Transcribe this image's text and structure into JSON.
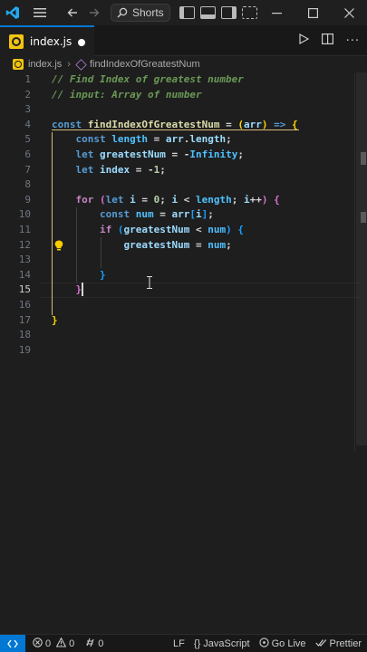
{
  "titlebar": {
    "search_label": "Shorts",
    "icons": [
      "vscode-logo",
      "menu-icon",
      "back-arrow-icon",
      "forward-arrow-icon",
      "search-icon",
      "layout-icons",
      "minimize-icon",
      "maximize-icon",
      "close-icon"
    ]
  },
  "tabs": [
    {
      "label": "index.js",
      "modified": true,
      "active": true
    }
  ],
  "breadcrumb": {
    "file": "index.js",
    "symbol": "findIndexOfGreatestNum"
  },
  "editor": {
    "line_numbers": [
      "1",
      "2",
      "3",
      "4",
      "5",
      "6",
      "7",
      "8",
      "9",
      "10",
      "11",
      "12",
      "13",
      "14",
      "15",
      "16",
      "17",
      "18",
      "19"
    ],
    "active_line": "15",
    "lines": [
      [
        [
          "cm",
          "// Find Index of greatest number"
        ]
      ],
      [
        [
          "cm",
          "// input: Array of number"
        ]
      ],
      [],
      [
        [
          "kw",
          "const "
        ],
        [
          "fn",
          "findIndexOfGreatestNum"
        ],
        [
          "op",
          " = "
        ],
        [
          "b1",
          "("
        ],
        [
          "var",
          "arr"
        ],
        [
          "b1",
          ")"
        ],
        [
          "op",
          " "
        ],
        [
          "kw",
          "=>"
        ],
        [
          "op",
          " "
        ],
        [
          "b1",
          "{"
        ]
      ],
      [
        [
          "op",
          "    "
        ],
        [
          "kw",
          "const "
        ],
        [
          "cnst",
          "length"
        ],
        [
          "op",
          " = "
        ],
        [
          "var",
          "arr"
        ],
        [
          "op",
          "."
        ],
        [
          "var",
          "length"
        ],
        [
          "op",
          ";"
        ]
      ],
      [
        [
          "op",
          "    "
        ],
        [
          "kw",
          "let "
        ],
        [
          "var",
          "greatestNum"
        ],
        [
          "op",
          " = -"
        ],
        [
          "cnst",
          "Infinity"
        ],
        [
          "op",
          ";"
        ]
      ],
      [
        [
          "op",
          "    "
        ],
        [
          "kw",
          "let "
        ],
        [
          "var",
          "index"
        ],
        [
          "op",
          " = -"
        ],
        [
          "num",
          "1"
        ],
        [
          "op",
          ";"
        ]
      ],
      [],
      [
        [
          "op",
          "    "
        ],
        [
          "ctl",
          "for "
        ],
        [
          "b2",
          "("
        ],
        [
          "kw",
          "let "
        ],
        [
          "var",
          "i"
        ],
        [
          "op",
          " = "
        ],
        [
          "num",
          "0"
        ],
        [
          "op",
          "; "
        ],
        [
          "var",
          "i"
        ],
        [
          "op",
          " < "
        ],
        [
          "cnst",
          "length"
        ],
        [
          "op",
          "; "
        ],
        [
          "var",
          "i"
        ],
        [
          "op",
          "++"
        ],
        [
          "b2",
          ")"
        ],
        [
          "op",
          " "
        ],
        [
          "b2",
          "{"
        ]
      ],
      [
        [
          "op",
          "        "
        ],
        [
          "kw",
          "const "
        ],
        [
          "cnst",
          "num"
        ],
        [
          "op",
          " = "
        ],
        [
          "var",
          "arr"
        ],
        [
          "b3",
          "["
        ],
        [
          "var",
          "i"
        ],
        [
          "b3",
          "]"
        ],
        [
          "op",
          ";"
        ]
      ],
      [
        [
          "op",
          "        "
        ],
        [
          "ctl",
          "if "
        ],
        [
          "b3",
          "("
        ],
        [
          "var",
          "greatestNum"
        ],
        [
          "op",
          " < "
        ],
        [
          "cnst",
          "num"
        ],
        [
          "b3",
          ")"
        ],
        [
          "op",
          " "
        ],
        [
          "b3",
          "{"
        ]
      ],
      [
        [
          "op",
          "            "
        ],
        [
          "var",
          "greatestNum"
        ],
        [
          "op",
          " = "
        ],
        [
          "cnst",
          "num"
        ],
        [
          "op",
          ";"
        ]
      ],
      [],
      [
        [
          "op",
          "        "
        ],
        [
          "b3",
          "}"
        ]
      ],
      [
        [
          "op",
          "    "
        ],
        [
          "b2",
          "}"
        ]
      ],
      [],
      [
        [
          "b1",
          "}"
        ]
      ],
      [],
      []
    ]
  },
  "statusbar": {
    "errors": "0",
    "warnings": "0",
    "ports": "0",
    "eol": "LF",
    "language": "JavaScript",
    "golive": "Go Live",
    "prettier": "Prettier"
  }
}
